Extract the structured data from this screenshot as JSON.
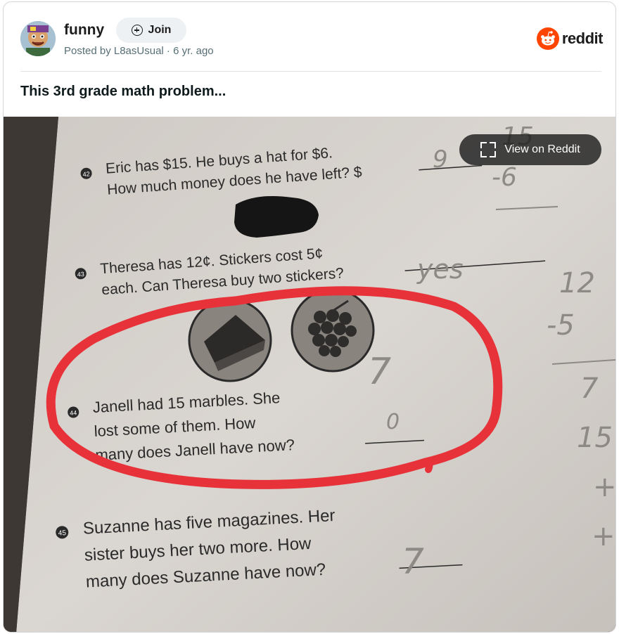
{
  "post": {
    "subreddit": "funny",
    "join_label": "Join",
    "posted_by": "Posted by L8asUsual · 6 yr. ago",
    "title": "This 3rd grade math problem..."
  },
  "brand": {
    "wordmark": "reddit",
    "accent": "#ff4500"
  },
  "media": {
    "view_label": "View on Reddit",
    "problems": [
      {
        "number": "42",
        "line1": "Eric has $15. He buys a hat for $6.",
        "line2": "How much money does he have left? $"
      },
      {
        "number": "43",
        "line1": "Theresa has 12¢. Stickers cost 5¢",
        "line2": "each. Can Theresa buy two stickers?"
      },
      {
        "number": "44",
        "line1": "Janell had 15 marbles. She",
        "line2": "lost some of them. How",
        "line3": "many does Janell have now?"
      },
      {
        "number": "45",
        "line1": "Suzanne has five magazines. Her",
        "line2": "sister buys her two more. How",
        "line3": "many does Suzanne have now?"
      }
    ],
    "handwriting": {
      "answer_42": "9",
      "work_42_top": "15",
      "work_42_bottom": "-6",
      "answer_43": "yes",
      "margin_12": "12",
      "margin_5": "-5",
      "margin_7": "7",
      "margin_15": "15",
      "margin_plus": "+",
      "answer_44a": "7",
      "answer_44b": "0",
      "answer_45": "7"
    },
    "circle_color": "#e8323a"
  }
}
